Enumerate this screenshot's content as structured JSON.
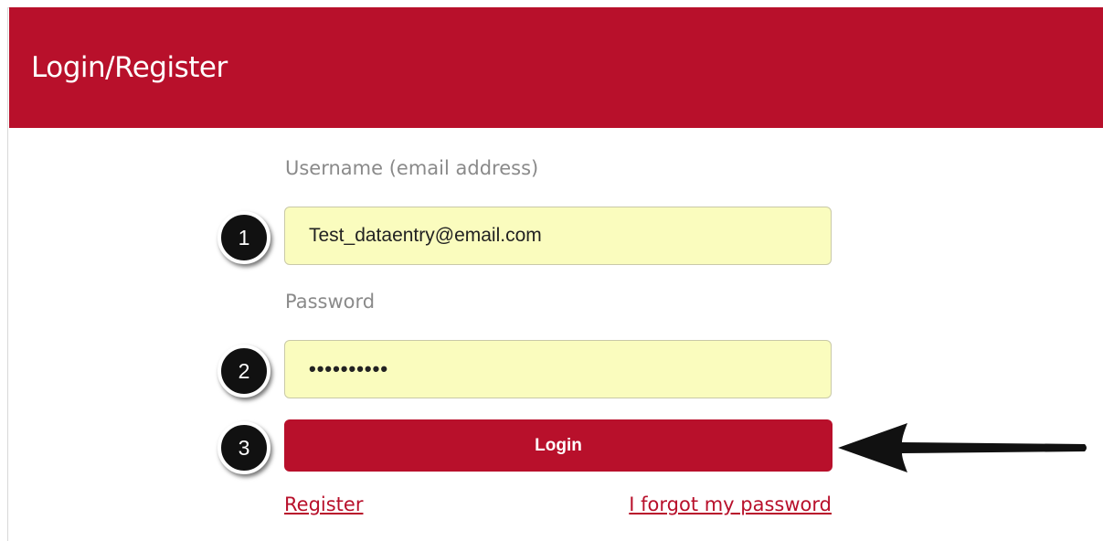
{
  "header": {
    "title": "Login/Register"
  },
  "form": {
    "username_label": "Username (email address)",
    "username_value": "Test_dataentry@email.com",
    "password_label": "Password",
    "password_value": "••••••••••",
    "login_label": "Login",
    "register_link": "Register",
    "forgot_link": "I forgot my password"
  },
  "annotations": {
    "step1": "1",
    "step2": "2",
    "step3": "3",
    "arrow_icon": "left-arrow-icon"
  },
  "colors": {
    "brand": "#b8102b",
    "input_bg": "#fafcbe",
    "badge": "#111111"
  }
}
